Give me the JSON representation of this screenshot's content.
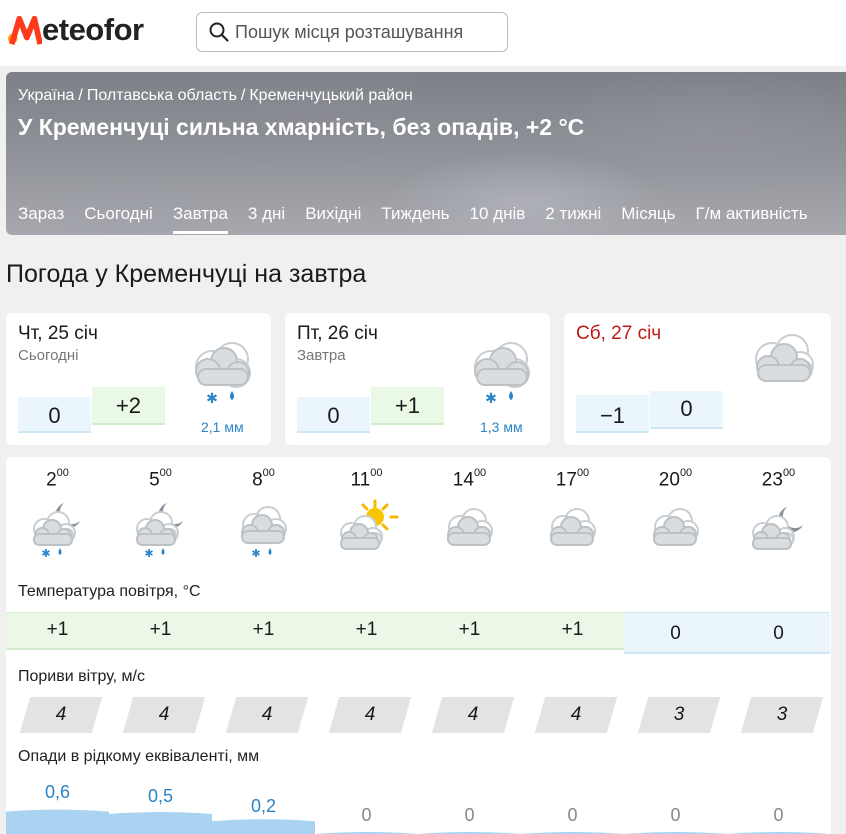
{
  "header": {
    "logo_text": "eteofor",
    "logo_letter": "M",
    "search_placeholder": "Пошук місця розташування"
  },
  "hero": {
    "breadcrumbs": [
      "Україна",
      "Полтавська область",
      "Кременчуцький район"
    ],
    "breadcrumb_sep": "/",
    "title": "У Кременчуці сильна хмарність, без опадів, +2 °C",
    "tabs": [
      "Зараз",
      "Сьогодні",
      "Завтра",
      "3 дні",
      "Вихідні",
      "Тиждень",
      "10 днів",
      "2 тижні",
      "Місяць",
      "Г/м активність"
    ],
    "active_tab": "Завтра"
  },
  "page_title": "Погода у Кременчуці на завтра",
  "days": [
    {
      "date": "Чт, 25 січ",
      "label": "Сьогодні",
      "tmin": "0",
      "tmax": "+2",
      "precip": "2,1 мм",
      "icon": "cloud-snow-rain-icon",
      "weekend": false
    },
    {
      "date": "Пт, 26 січ",
      "label": "Завтра",
      "tmin": "0",
      "tmax": "+1",
      "precip": "1,3 мм",
      "icon": "cloud-snow-rain-icon",
      "weekend": false
    },
    {
      "date": "Сб, 27 січ",
      "label": "",
      "tmin": "−1",
      "tmax": "0",
      "precip": "",
      "icon": "cloud-icon",
      "weekend": true
    }
  ],
  "hourly": {
    "hours": [
      "2",
      "5",
      "8",
      "11",
      "14",
      "17",
      "20",
      "23"
    ],
    "minutes": "00",
    "icons": [
      "night-cloud-snow-rain-icon",
      "night-cloud-snow-rain-icon",
      "cloud-snow-rain-icon",
      "sun-cloud-icon",
      "cloud-icon",
      "cloud-icon",
      "cloud-icon",
      "night-cloud-icon"
    ],
    "temp_label": "Температура повітря, °C",
    "temps": [
      "+1",
      "+1",
      "+1",
      "+1",
      "+1",
      "+1",
      "0",
      "0"
    ],
    "gust_label": "Пориви вітру, м/с",
    "gusts": [
      "4",
      "4",
      "4",
      "4",
      "4",
      "4",
      "3",
      "3"
    ],
    "precip_label": "Опади в рідкому еквіваленті, мм",
    "precip": [
      "0,6",
      "0,5",
      "0,2",
      "0",
      "0",
      "0",
      "0",
      "0"
    ]
  },
  "colors": {
    "accent": "#ff6a00",
    "precip_blue": "#2b84c8",
    "weekend_red": "#c01818",
    "warm_bg": "#ebf8e7",
    "cold_bg": "#eaf6fb"
  }
}
